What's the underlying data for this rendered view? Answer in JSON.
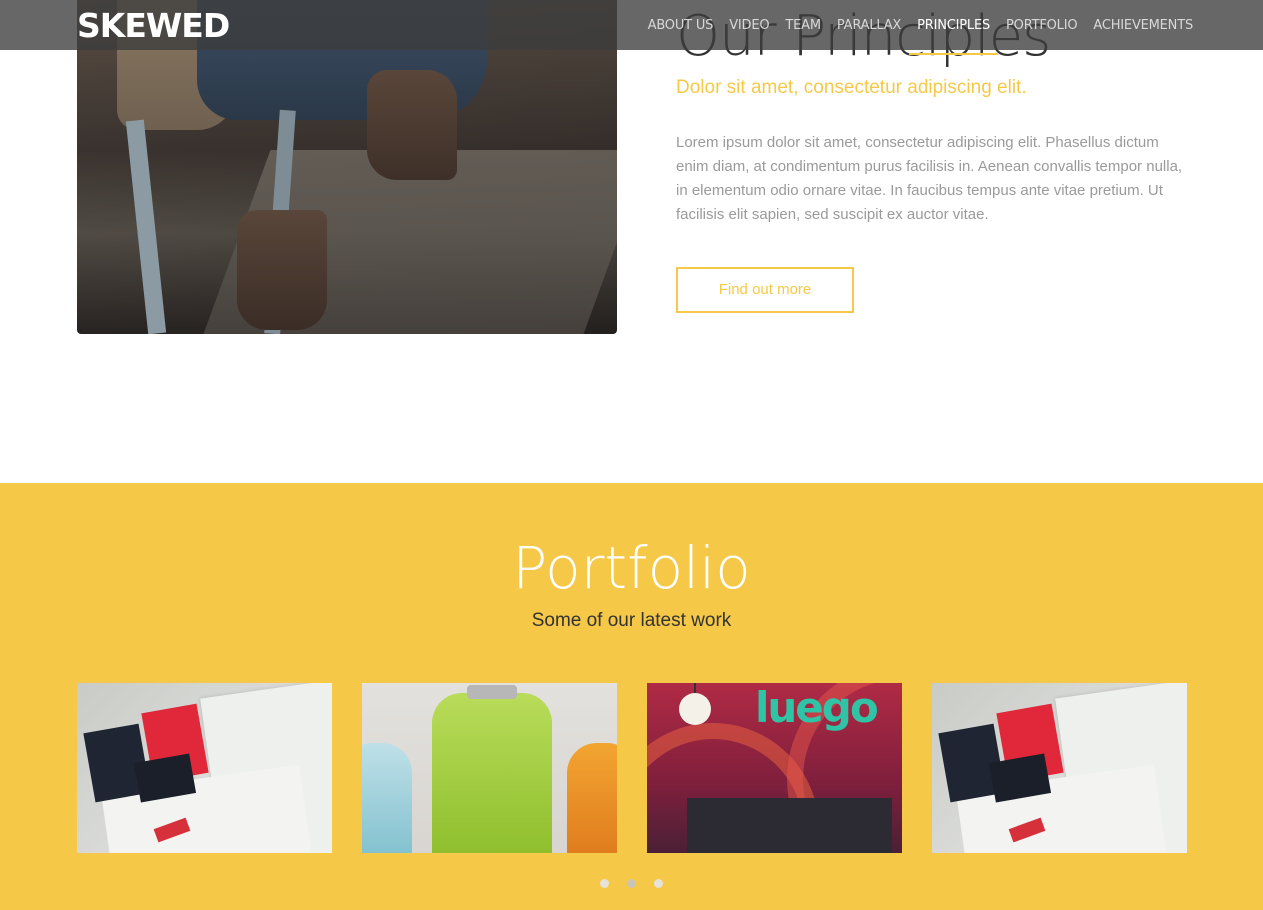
{
  "header": {
    "logo": "SKEWED",
    "nav": [
      {
        "label": "ABOUT US",
        "active": false
      },
      {
        "label": "VIDEO",
        "active": false
      },
      {
        "label": "TEAM",
        "active": false
      },
      {
        "label": "PARALLAX",
        "active": false
      },
      {
        "label": "PRINCIPLES",
        "active": true
      },
      {
        "label": "PORTFOLIO",
        "active": false
      },
      {
        "label": "ACHIEVEMENTS",
        "active": false
      }
    ]
  },
  "principles": {
    "title": "Our Principles",
    "subtitle": "Dolor sit amet, consectetur adipiscing elit.",
    "body": "Lorem ipsum dolor sit amet, consectetur adipiscing elit. Phasellus dictum enim diam, at condimentum purus facilisis in. Aenean convallis tempor nulla, in elementum odio ornare vitae. In faucibus tempus ante vitae pretium. Ut facilisis elit sapien, sed suscipit ex auctor vitae.",
    "cta_label": "Find out more"
  },
  "portfolio": {
    "title": "Portfolio",
    "subtitle": "Some of our latest work",
    "items": [
      {
        "name": "stationery"
      },
      {
        "name": "bottles"
      },
      {
        "name": "luego",
        "text": "luego"
      },
      {
        "name": "stationery"
      }
    ],
    "pagination": {
      "count": 3,
      "active_index": 1
    }
  },
  "colors": {
    "accent": "#f5c947",
    "nav_bg": "#3c3c3c",
    "text_dark": "#333333",
    "text_muted": "#9a9a9a"
  }
}
